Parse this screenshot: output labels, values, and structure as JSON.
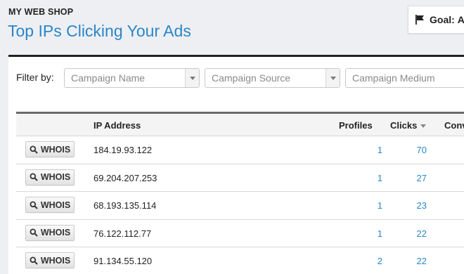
{
  "header": {
    "shop_name": "MY WEB SHOP",
    "title": "Top IPs Clicking Your Ads",
    "goal_label": "Goal:",
    "goal_value": "Al"
  },
  "filters": {
    "label": "Filter by:",
    "campaign_name": "Campaign Name",
    "campaign_source": "Campaign Source",
    "campaign_medium": "Campaign Medium"
  },
  "table": {
    "columns": {
      "ip": "IP Address",
      "profiles": "Profiles",
      "clicks": "Clicks",
      "conversions": "Conv"
    },
    "whois_label": "WHOIS",
    "rows": [
      {
        "ip": "184.19.93.122",
        "profiles": "1",
        "clicks": "70"
      },
      {
        "ip": "69.204.207.253",
        "profiles": "1",
        "clicks": "27"
      },
      {
        "ip": "68.193.135.114",
        "profiles": "1",
        "clicks": "23"
      },
      {
        "ip": "76.122.112.77",
        "profiles": "1",
        "clicks": "22"
      },
      {
        "ip": "91.134.55.120",
        "profiles": "2",
        "clicks": "22"
      }
    ]
  },
  "colors": {
    "accent": "#2a86c8",
    "page_background": "#eeeff2"
  }
}
